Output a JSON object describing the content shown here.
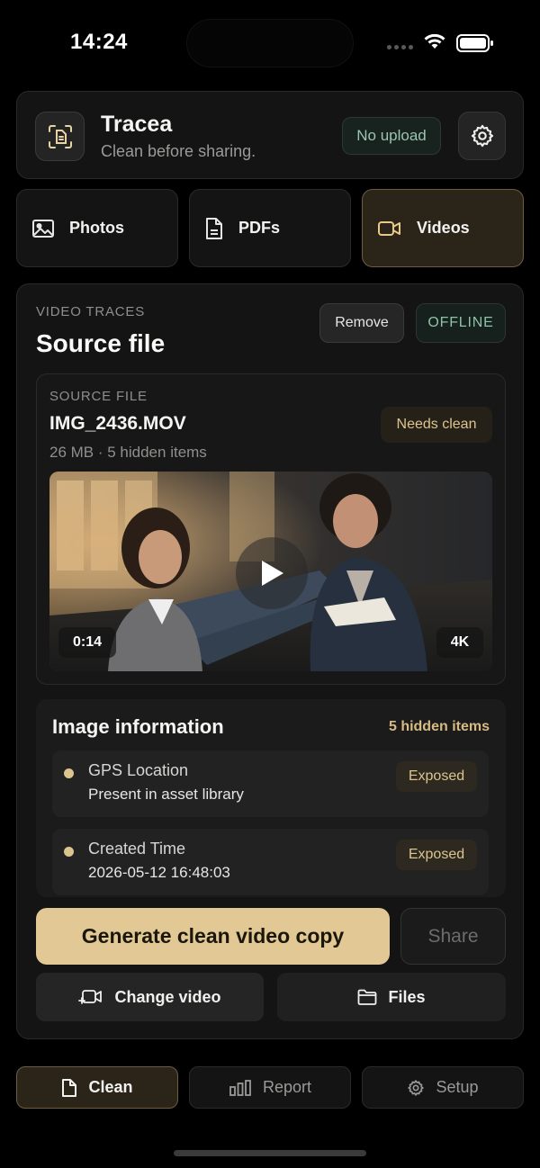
{
  "status_bar": {
    "time": "14:24"
  },
  "header": {
    "title": "Tracea",
    "subtitle": "Clean before sharing.",
    "upload_badge": "No upload",
    "icons": {
      "logo": "document-scan-icon",
      "settings": "gear-icon"
    }
  },
  "type_tabs": [
    {
      "label": "Photos",
      "icon": "photo-icon",
      "selected": false
    },
    {
      "label": "PDFs",
      "icon": "document-icon",
      "selected": false
    },
    {
      "label": "Videos",
      "icon": "video-camera-icon",
      "selected": true
    }
  ],
  "traces_section": {
    "eyebrow": "VIDEO TRACES",
    "title": "Source file",
    "remove_label": "Remove",
    "offline_badge": "OFFLINE"
  },
  "source_file": {
    "eyebrow": "SOURCE FILE",
    "name": "IMG_2436.MOV",
    "meta": "26 MB · 5 hidden items",
    "status_badge": "Needs clean",
    "duration": "0:14",
    "quality": "4K"
  },
  "image_information": {
    "title": "Image information",
    "count": "5 hidden items",
    "rows": [
      {
        "name": "GPS Location",
        "value": "Present in asset library",
        "status": "Exposed"
      },
      {
        "name": "Created Time",
        "value": "2026-05-12 16:48:03",
        "status": "Exposed"
      }
    ]
  },
  "actions": {
    "generate_label": "Generate clean video copy",
    "share_label": "Share",
    "change_label": "Change video",
    "files_label": "Files"
  },
  "bottom_nav": [
    {
      "label": "Clean",
      "icon": "document-icon",
      "selected": true
    },
    {
      "label": "Report",
      "icon": "bar-chart-icon",
      "selected": false
    },
    {
      "label": "Setup",
      "icon": "gear-icon",
      "selected": false
    }
  ],
  "colors": {
    "accent": "#E1C894",
    "background": "#000000",
    "card": "#141414",
    "ok": "#8EC3A8"
  }
}
